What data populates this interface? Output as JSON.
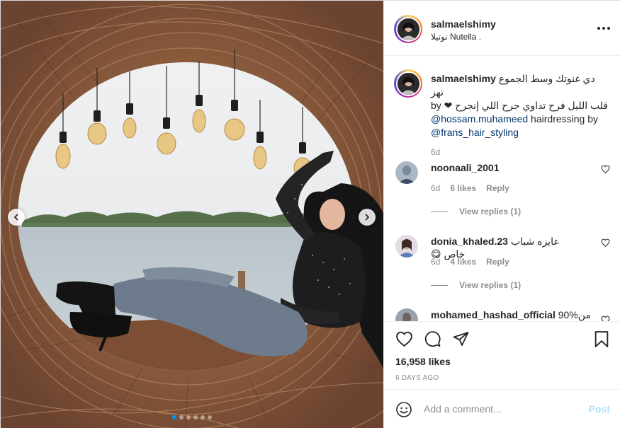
{
  "post": {
    "username": "salmaelshimy",
    "location": "نوتيلا Nutella .",
    "more_icon": "more-horizontal-icon"
  },
  "caption": {
    "username": "salmaelshimy",
    "text_line1": "دي غنوتك وسط الجموع تهز",
    "text_line2": "قلب الليل فرح تداوي جرح اللي إنجرح ❤ by",
    "mention1": "@hossam.muhameed",
    "text_mid": " hairdressing by",
    "mention2": "@frans_hair_styling",
    "time": "6d"
  },
  "comments": [
    {
      "username": "noonaali_2001",
      "text": "",
      "time": "6d",
      "likes": "6 likes",
      "reply": "Reply",
      "view_replies": "View replies (1)"
    },
    {
      "username": "donia_khaled.23",
      "text": "عايزه شباب خاص 😋",
      "time": "6d",
      "likes": "4 likes",
      "reply": "Reply",
      "view_replies": "View replies (1)"
    },
    {
      "username": "mohamed_hashad_official",
      "text": "90%من"
    }
  ],
  "actions": {
    "likes": "16,958 likes",
    "ago": "6 DAYS AGO"
  },
  "add_comment": {
    "placeholder": "Add a comment...",
    "post_label": "Post"
  },
  "carousel": {
    "total": 6,
    "active": 0
  },
  "colors": {
    "accent": "#0095f6",
    "text": "#262626",
    "muted": "#8e8e8e",
    "mention": "#00376b",
    "post_disabled": "#b2dffc"
  }
}
